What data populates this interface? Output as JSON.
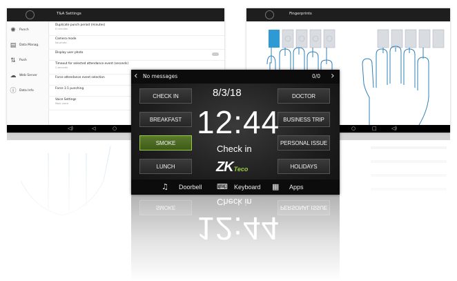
{
  "left_screen": {
    "title": "T&A Settings",
    "sidebar": [
      {
        "label": "Punch",
        "icon": "fingerprint-icon"
      },
      {
        "label": "Data Manag.",
        "icon": "database-icon"
      },
      {
        "label": "Push",
        "icon": "sort-arrows-icon"
      },
      {
        "label": "Web Server",
        "icon": "cloud-icon"
      },
      {
        "label": "Data Info",
        "icon": "info-icon"
      }
    ],
    "settings": [
      {
        "title": "Duplicate punch period (minutes)",
        "sub": "0 minutes"
      },
      {
        "title": "Camera mode",
        "sub": "No photo"
      },
      {
        "title": "Display user photo",
        "sub": ""
      },
      {
        "title": "Timeout for selected attendance event (seconds)",
        "sub": "2 seconds"
      },
      {
        "title": "Force attendance event selection",
        "sub": ""
      },
      {
        "title": "Force 1:1 punching",
        "sub": ""
      },
      {
        "title": "Voice Settings",
        "sub": "Male voice"
      }
    ]
  },
  "right_screen": {
    "title": "Fingerprints"
  },
  "device": {
    "top_bar": {
      "message": "No messages",
      "counter": "0/0"
    },
    "date": "8/3/18",
    "time": "12:44",
    "status": "Check in",
    "logo": {
      "main": "ZK",
      "sub": "Teco"
    },
    "left_buttons": [
      "CHECK IN",
      "BREAKFAST",
      "SMOKE",
      "LUNCH"
    ],
    "right_buttons": [
      "DOCTOR",
      "BUSINESS TRIP",
      "PERSONAL ISSUE",
      "HOLIDAYS"
    ],
    "selected_button": "SMOKE",
    "bottom_bar": [
      {
        "label": "Doorbell",
        "icon": "bell-icon"
      },
      {
        "label": "Keyboard",
        "icon": "keyboard-icon"
      },
      {
        "label": "Apps",
        "icon": "apps-grid-icon"
      }
    ]
  },
  "colors": {
    "accent_green": "#9bcc45",
    "fingerprint_blue": "#2d9ad6",
    "header_dark": "#1e1e1e"
  }
}
